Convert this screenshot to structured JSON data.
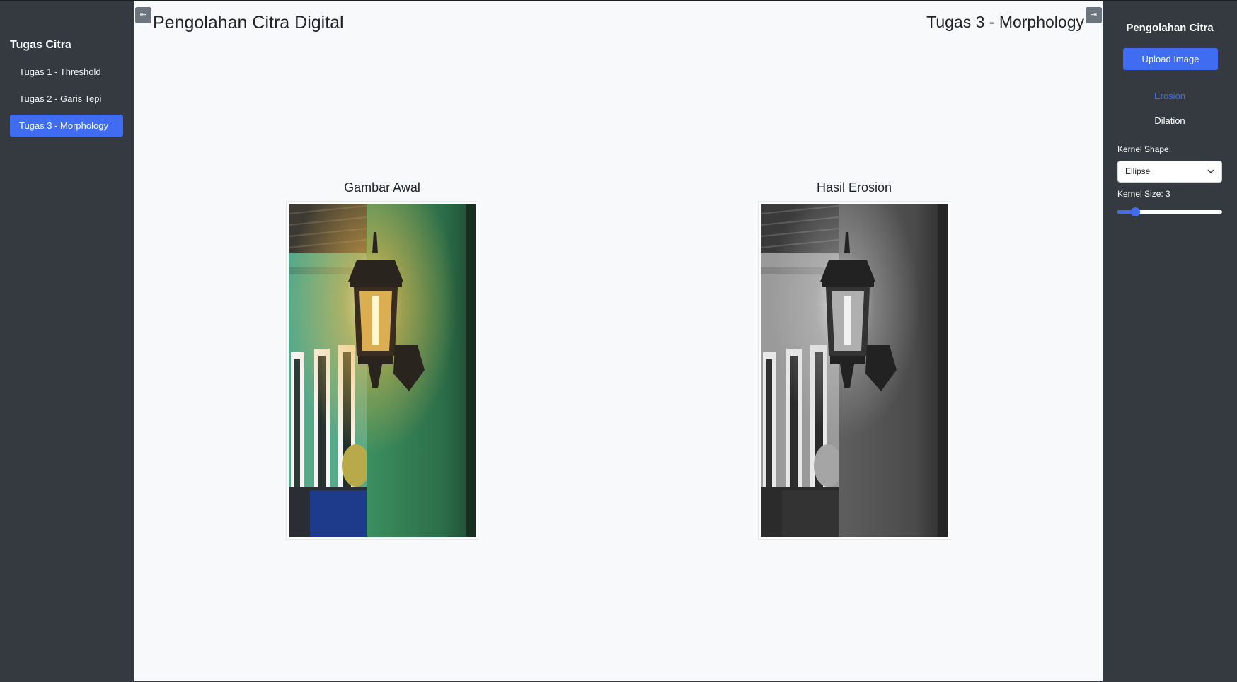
{
  "left_sidebar": {
    "title": "Tugas Citra",
    "items": [
      {
        "label": "Tugas 1 - Threshold",
        "active": false
      },
      {
        "label": "Tugas 2 - Garis Tepi",
        "active": false
      },
      {
        "label": "Tugas 3 - Morphology",
        "active": true
      }
    ]
  },
  "header": {
    "title": "Pengolahan Citra Digital",
    "subtitle": "Tugas 3 - Morphology",
    "toggle_left_glyph": "⇤",
    "toggle_right_glyph": "⇥"
  },
  "panels": {
    "original_caption": "Gambar Awal",
    "result_caption": "Hasil Erosion"
  },
  "right_sidebar": {
    "title": "Pengolahan Citra",
    "upload_label": "Upload Image",
    "operations": [
      "Erosion",
      "Dilation"
    ],
    "active_operation": "Erosion",
    "kernel_shape_label": "Kernel Shape:",
    "kernel_shape_value": "Ellipse",
    "kernel_size_label": "Kernel Size: 3",
    "kernel_size_fraction": 0.17
  },
  "colors": {
    "accent": "#3f6cf0",
    "sidebar_bg": "#343a40",
    "main_bg": "#f8f9fa"
  },
  "icons": {
    "collapse_left": "arrow-to-left-icon",
    "collapse_right": "arrow-to-right-icon",
    "select_caret": "chevron-down-icon"
  }
}
